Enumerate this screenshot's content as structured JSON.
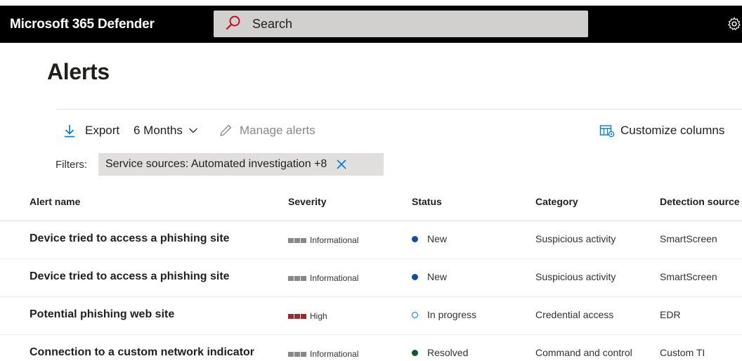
{
  "app": {
    "title": "Microsoft 365 Defender",
    "search_placeholder": "Search",
    "search_icon": "search-icon",
    "settings_icon": "gear-icon"
  },
  "page": {
    "title": "Alerts"
  },
  "toolbar": {
    "export_label": "Export",
    "export_icon": "download-icon",
    "range_label": "6 Months",
    "range_icon": "chevron-down-icon",
    "manage_label": "Manage alerts",
    "manage_icon": "edit-icon",
    "customize_label": "Customize columns",
    "customize_icon": "columns-icon"
  },
  "filters": {
    "label": "Filters:",
    "chip_label": "Service sources: Automated investigation +8",
    "chip_icon": "close-icon"
  },
  "table": {
    "columns": [
      "Alert name",
      "Severity",
      "Status",
      "Category",
      "Detection source"
    ],
    "rows": [
      {
        "name": "Device tried to access a phishing site",
        "severity": "Informational",
        "severity_color": "#8a8886",
        "status": "New",
        "status_color": "#0f4fa8",
        "status_style": "filled",
        "category": "Suspicious activity",
        "source": "SmartScreen"
      },
      {
        "name": "Device tried to access a phishing site",
        "severity": "Informational",
        "severity_color": "#8a8886",
        "status": "New",
        "status_color": "#0f4fa8",
        "status_style": "filled",
        "category": "Suspicious activity",
        "source": "SmartScreen"
      },
      {
        "name": "Potential phishing web site",
        "severity": "High",
        "severity_color": "#a4262c",
        "status": "In progress",
        "status_color": "#0078d4",
        "status_style": "hollow",
        "category": "Credential access",
        "source": "EDR"
      },
      {
        "name": "Connection to a custom network indicator",
        "severity": "Informational",
        "severity_color": "#8a8886",
        "status": "Resolved",
        "status_color": "#0b5a2a",
        "status_style": "filled",
        "category": "Command and control",
        "source": "Custom TI"
      }
    ]
  },
  "colors": {
    "accent": "#0078d4",
    "topbar": "#000000",
    "search_bg": "#d2d0ce",
    "chip_bg": "#e1dfdd",
    "search_icon": "#c50f1f"
  }
}
